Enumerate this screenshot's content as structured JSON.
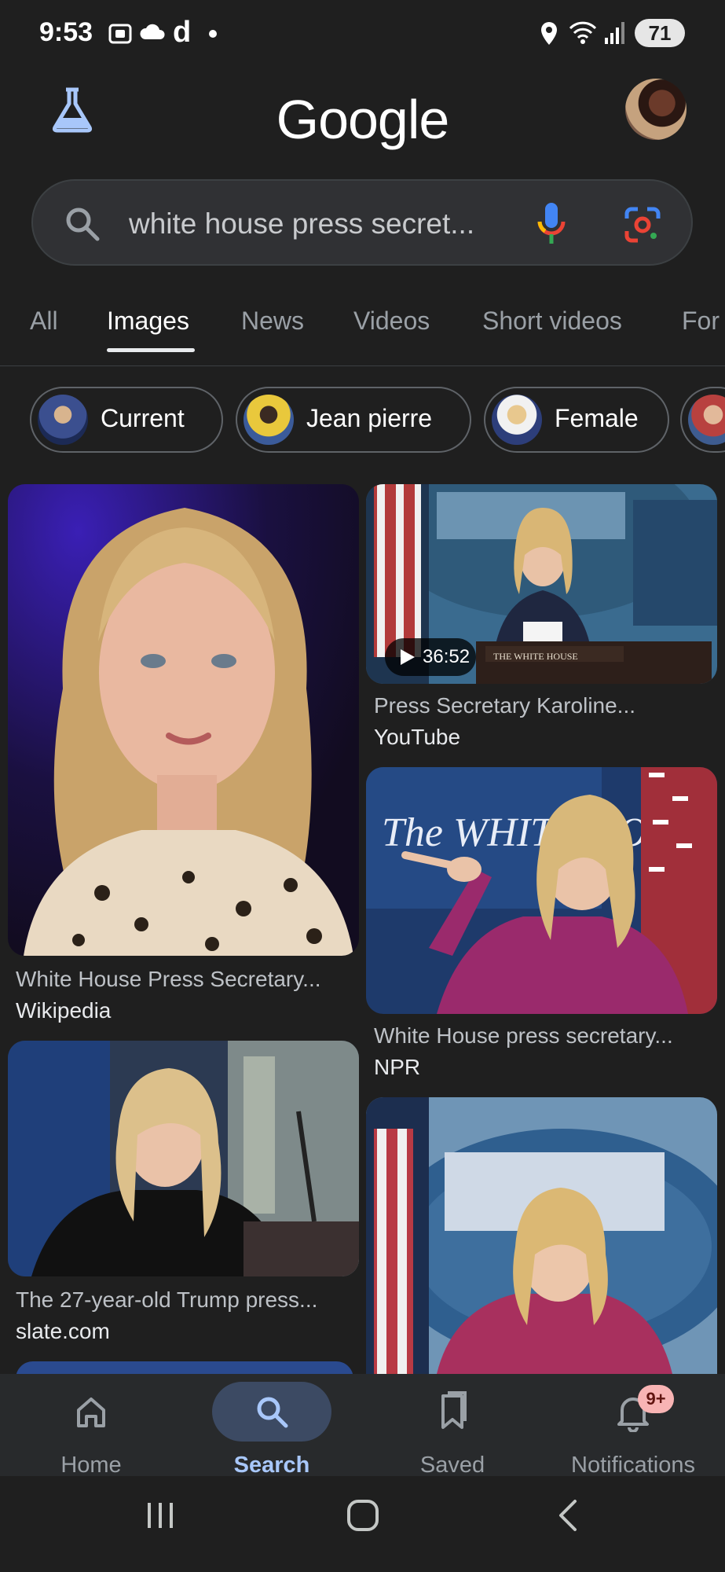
{
  "status_bar": {
    "time": "9:53",
    "battery": "71"
  },
  "header": {
    "logo_text": "Google"
  },
  "search": {
    "query": "white house press secret..."
  },
  "tabs": [
    {
      "label": "All",
      "active": false
    },
    {
      "label": "Images",
      "active": true
    },
    {
      "label": "News",
      "active": false
    },
    {
      "label": "Videos",
      "active": false
    },
    {
      "label": "Short videos",
      "active": false
    },
    {
      "label": "For",
      "active": false
    }
  ],
  "chips": [
    {
      "label": "Current"
    },
    {
      "label": "Jean pierre"
    },
    {
      "label": "Female"
    }
  ],
  "results": [
    {
      "title": "White House Press Secretary...",
      "source": "Wikipedia"
    },
    {
      "title": "Press Secretary Karoline...",
      "source": "YouTube",
      "duration": "36:52"
    },
    {
      "title": "White House press secretary...",
      "source": "NPR"
    },
    {
      "title": "The 27-year-old Trump press...",
      "source": "slate.com"
    }
  ],
  "bottom_nav": {
    "items": [
      {
        "label": "Home",
        "icon": "home-icon"
      },
      {
        "label": "Search",
        "icon": "search-icon",
        "active": true
      },
      {
        "label": "Saved",
        "icon": "bookmark-icon"
      },
      {
        "label": "Notifications",
        "icon": "bell-icon",
        "badge": "9+"
      }
    ]
  },
  "colors": {
    "background": "#1f1f1f",
    "accent": "#a8c7fa",
    "badge": "#f8b4b4"
  }
}
